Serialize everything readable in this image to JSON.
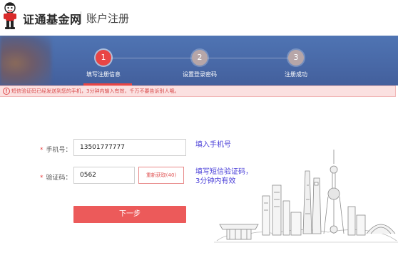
{
  "header": {
    "brand": "证通基金网",
    "title": "账户注册"
  },
  "steps": [
    {
      "number": "1",
      "label": "填写注册信息",
      "active": true
    },
    {
      "number": "2",
      "label": "设置登录密码",
      "active": false
    },
    {
      "number": "3",
      "label": "注册成功",
      "active": false
    }
  ],
  "alert": {
    "icon": "exclamation-icon",
    "text": "短信验证码已经发送到您的手机，3分钟内输入有效，千万不要告诉别人哦。"
  },
  "form": {
    "phone_label": "手机号：",
    "phone_value": "13501777777",
    "code_label": "验证码：",
    "code_value": "0562",
    "resend_label": "重新获取(40)",
    "submit_label": "下一步"
  },
  "hints": {
    "phone": "填入手机号",
    "code_line1": "填写短信验证码，",
    "code_line2": "3分钟内有效"
  },
  "colors": {
    "accent": "#e84545",
    "banner": "#4a6aa8",
    "hint": "#4a3fd8"
  }
}
